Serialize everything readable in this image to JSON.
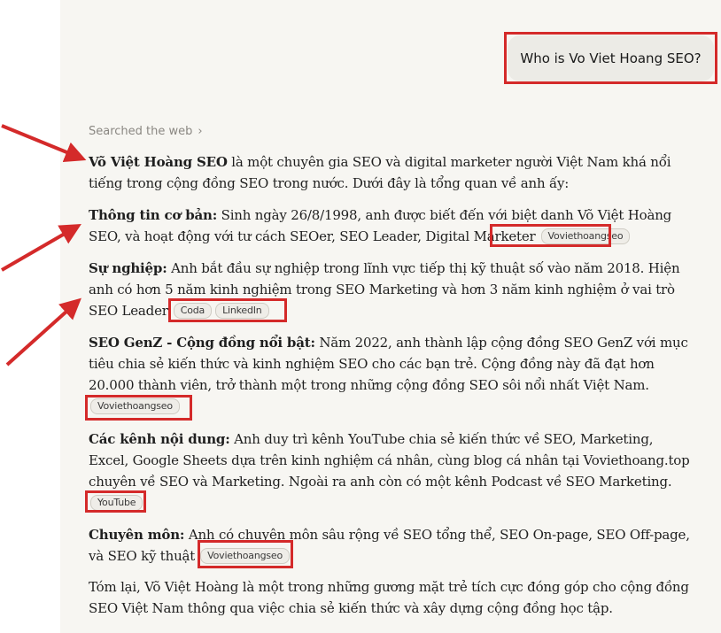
{
  "user_message": "Who is Vo Viet Hoang SEO?",
  "searched_label": "Searched the web",
  "searched_chevron": "›",
  "paragraphs": {
    "intro_bold": "Võ Việt Hoàng SEO",
    "intro_text": " là một chuyên gia SEO và digital marketer người Việt Nam khá nổi tiếng trong cộng đồng SEO trong nước. Dưới đây là tổng quan về anh ấy:",
    "basic_bold": "Thông tin cơ bản:",
    "basic_text": " Sinh ngày 26/8/1998, anh được biết đến với biệt danh Võ Việt Hoàng SEO, và hoạt động với tư cách SEOer, SEO Leader, Digital Marketer",
    "career_bold": "Sự nghiệp:",
    "career_text": " Anh bắt đầu sự nghiệp trong lĩnh vực tiếp thị kỹ thuật số vào năm 2018. Hiện anh có hơn 5 năm kinh nghiệm trong SEO Marketing và hơn 3 năm kinh nghiệm ở vai trò SEO Leader",
    "genz_bold": "SEO GenZ - Cộng đồng nổi bật:",
    "genz_text": " Năm 2022, anh thành lập cộng đồng SEO GenZ với mục tiêu chia sẻ kiến thức và kinh nghiệm SEO cho các bạn trẻ. Cộng đồng này đã đạt hơn 20.000 thành viên, trở thành một trong những cộng đồng SEO sôi nổi nhất Việt Nam.",
    "channels_bold": "Các kênh nội dung:",
    "channels_text": " Anh duy trì kênh YouTube chia sẻ kiến thức về SEO, Marketing, Excel, Google Sheets dựa trên kinh nghiệm cá nhân, cùng blog cá nhân tại Voviethoang.top chuyên về SEO và Marketing. Ngoài ra anh còn có một kênh Podcast về SEO Marketing.",
    "expertise_bold": "Chuyên môn:",
    "expertise_text": " Anh có chuyên môn sâu rộng về SEO tổng thể, SEO On-page, SEO Off-page, và SEO kỹ thuật",
    "summary_text": "Tóm lại, Võ Việt Hoàng là một trong những gương mặt trẻ tích cực đóng góp cho cộng đồng SEO Việt Nam thông qua việc chia sẻ kiến thức và xây dựng cộng đồng học tập."
  },
  "citations": {
    "basic": [
      "Voviethoangseo"
    ],
    "career": [
      "Coda",
      "LinkedIn"
    ],
    "genz": [
      "Voviethoangseo"
    ],
    "channels": [
      "YouTube"
    ],
    "expertise": [
      "Voviethoangseo"
    ]
  },
  "colors": {
    "highlight": "#d42a2a",
    "panel_bg": "#f7f6f2",
    "bubble_bg": "#ecebe6",
    "chip_bg": "#efede8"
  }
}
